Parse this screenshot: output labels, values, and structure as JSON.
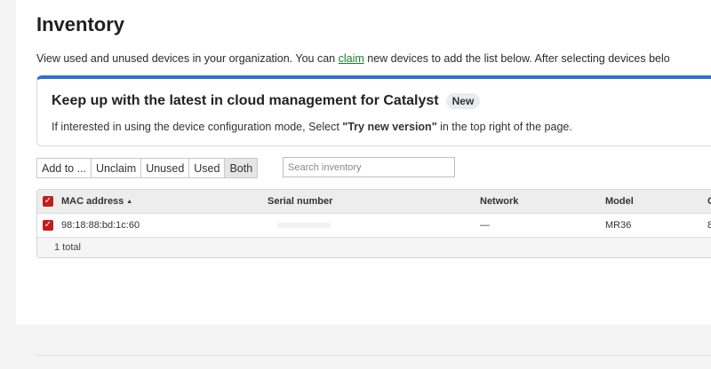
{
  "page": {
    "title": "Inventory",
    "description_before": "View used and unused devices in your organization. You can ",
    "description_link": "claim",
    "description_after": " new devices to add the list below. After selecting devices belo"
  },
  "banner": {
    "title": "Keep up with the latest in cloud management for Catalyst",
    "badge": "New",
    "text_before": "If interested in using the device configuration mode, Select ",
    "text_bold": "\"Try new version\"",
    "text_after": " in the top right of the page.",
    "accent_color": "#2f6fd1"
  },
  "toolbar": {
    "add_to": "Add to ...",
    "unclaim": "Unclaim",
    "unused": "Unused",
    "used": "Used",
    "both": "Both",
    "search_placeholder": "Search inventory"
  },
  "table": {
    "headers": {
      "mac": "MAC address",
      "sort_indicator": "▲",
      "serial": "Serial number",
      "network": "Network",
      "model": "Model",
      "extra": "C"
    },
    "rows": [
      {
        "mac": "98:18:88:bd:1c:60",
        "serial": "",
        "network": "—",
        "model": "MR36",
        "extra": "8"
      }
    ],
    "footer": "1 total"
  },
  "colors": {
    "checkbox": "#c21d1d",
    "link": "#1a7f2a"
  }
}
